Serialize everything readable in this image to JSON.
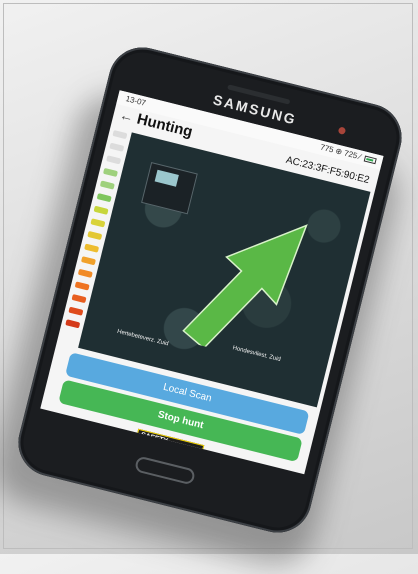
{
  "status_bar": {
    "time": "13-07",
    "network": "775 ⊕ 725 ⁄"
  },
  "device": {
    "brand": "SAMSUNG"
  },
  "header": {
    "back_icon": "back-arrow-icon",
    "title": "Hunting",
    "device_id": "AC:23:3F:F5:90:E2"
  },
  "map": {
    "arrow_icon": "direction-arrow-icon",
    "labels": [
      "Hertebeteverz. Zuid",
      "Hondesvliest. Zuid"
    ]
  },
  "signal_meter": {
    "colors": [
      "#dcdcdc",
      "#dcdcdc",
      "#dcdcdc",
      "#9fd17d",
      "#9fd17d",
      "#7fc65e",
      "#c7d63b",
      "#d9d33a",
      "#e3c834",
      "#eebd2f",
      "#f1a12a",
      "#f18b27",
      "#ef7422",
      "#e85e1f",
      "#df4b1c",
      "#d43a1a"
    ]
  },
  "actions": {
    "local_scan": "Local Scan",
    "stop_hunt": "Stop hunt"
  },
  "logo": {
    "line1": "SAFETY",
    "line2": "JUGGER"
  },
  "colors": {
    "scan": "#58a9df",
    "stop": "#46b755",
    "arrow": "#5ab846"
  }
}
